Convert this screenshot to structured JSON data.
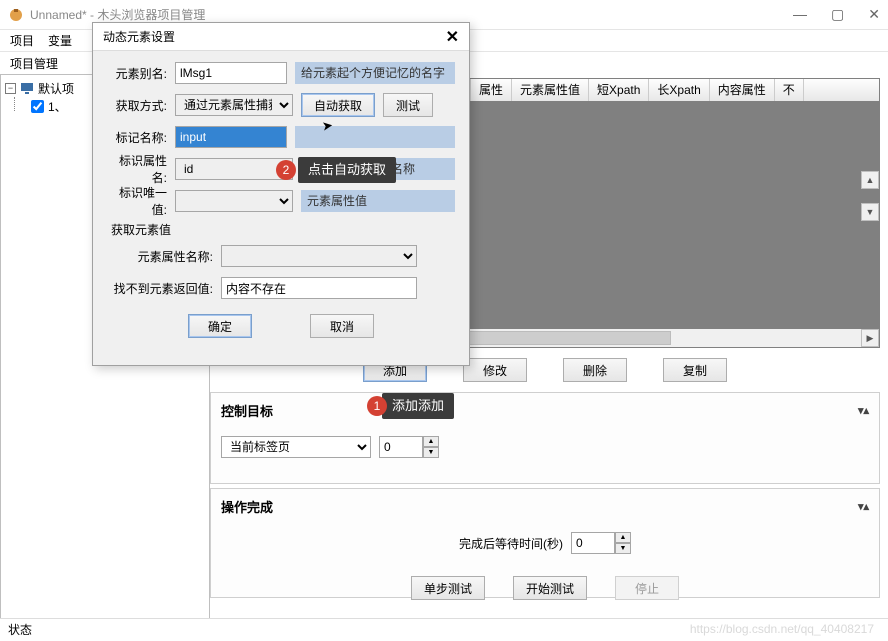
{
  "window": {
    "title": "Unnamed* - 木头浏览器项目管理",
    "min": "—",
    "max": "▢",
    "close": "✕"
  },
  "menu": {
    "project": "项目",
    "variable": "变量"
  },
  "submenu": {
    "project_manage": "项目管理"
  },
  "tree": {
    "root": "默认项",
    "child1": "1、"
  },
  "table": {
    "headers": [
      "属性",
      "元素属性值",
      "短Xpath",
      "长Xpath",
      "内容属性",
      "不"
    ]
  },
  "actions": {
    "add": "添加",
    "modify": "修改",
    "delete": "删除",
    "copy": "复制"
  },
  "panel_ctrl": {
    "title": "控制目标",
    "tab_label": "当前标签页",
    "index_value": "0"
  },
  "panel_done": {
    "title": "操作完成",
    "wait_label": "完成后等待时间(秒)",
    "wait_value": "0",
    "step_test": "单步测试",
    "start_test": "开始测试",
    "stop": "停止"
  },
  "statusbar": {
    "label": "状态"
  },
  "watermark": "https://blog.csdn.net/qq_40408217",
  "modal": {
    "title": "动态元素设置",
    "alias_label": "元素别名:",
    "alias_value": "lMsg1",
    "alias_hint": "给元素起个方便记忆的名字",
    "method_label": "获取方式:",
    "method_value": "通过元素属性捕获",
    "auto_btn": "自动获取",
    "test_btn": "测试",
    "tag_label": "标记名称:",
    "tag_value": "input",
    "tag_hint": "",
    "attr_label": "标识属性名:",
    "attr_value": "id",
    "attr_hint": "元素属性或事件名称",
    "val_label": "标识唯一值:",
    "val_value": "",
    "val_hint": "元素属性值",
    "group2_title": "获取元素值",
    "prop_label": "元素属性名称:",
    "prop_value": "",
    "miss_label": "找不到元素返回值:",
    "miss_value": "内容不存在",
    "ok": "确定",
    "cancel": "取消"
  },
  "callouts": {
    "c1_num": "1",
    "c1_text": "添加添加",
    "c2_num": "2",
    "c2_text": "点击自动获取"
  }
}
